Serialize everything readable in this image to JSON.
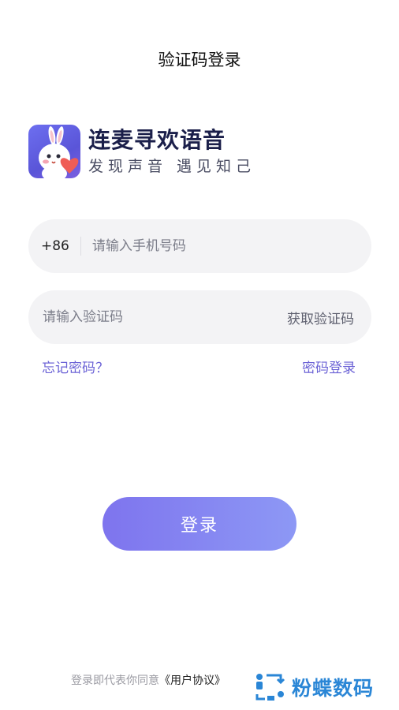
{
  "header": {
    "title": "验证码登录"
  },
  "brand": {
    "name": "连麦寻欢语音",
    "slogan": "发现声音 遇见知己",
    "colors": {
      "icon_bg": "#5a55d8",
      "heart": "#ef5d56"
    }
  },
  "phone": {
    "prefix": "+86",
    "placeholder": "请输入手机号码"
  },
  "code": {
    "placeholder": "请输入验证码",
    "get_code": "获取验证码"
  },
  "links": {
    "forgot": "忘记密码？",
    "password_login": "密码登录"
  },
  "login": {
    "label": "登录"
  },
  "agreement": {
    "prefix": "登录即代表你同意",
    "link": "《用户协议》"
  },
  "watermark": {
    "text": "粉蝶数码"
  },
  "colors": {
    "accent": "#6c63d6",
    "button_start": "#7e74ee",
    "button_end": "#8d98f5",
    "field_bg": "#f3f3f5"
  }
}
